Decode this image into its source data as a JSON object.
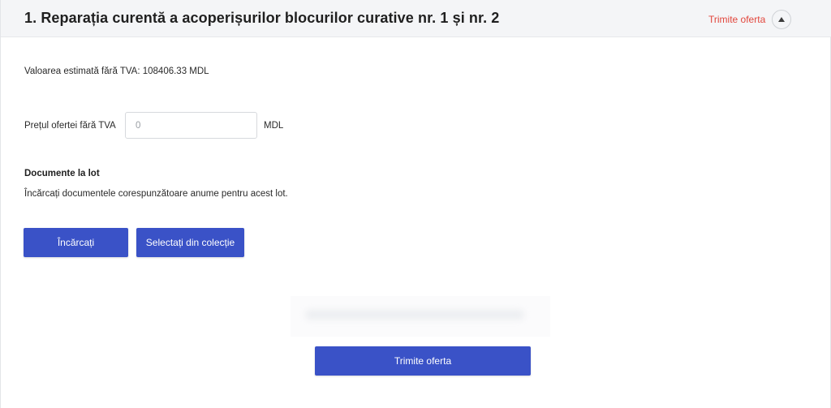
{
  "lot": {
    "title": "1. Reparația curentă a acoperișurilor blocurilor curative nr. 1 și nr. 2",
    "send_link": "Trimite oferta",
    "collapse_icon": "triangle-up-icon"
  },
  "estimate": {
    "text": "Valoarea estimată fără TVA: 108406.33 MDL"
  },
  "price": {
    "label": "Prețul ofertei fără TVA",
    "placeholder": "0",
    "currency": "MDL"
  },
  "documents": {
    "title": "Documente la lot",
    "description": "Încărcați documentele corespunzătoare anume pentru acest lot.",
    "upload_label": "Încărcați",
    "collection_label": "Selectați din colecție"
  },
  "footer": {
    "submit_label": "Trimite oferta"
  },
  "colors": {
    "accent": "#3a52c7",
    "link_red": "#e2463c",
    "header_bg": "#f4f5f7"
  }
}
